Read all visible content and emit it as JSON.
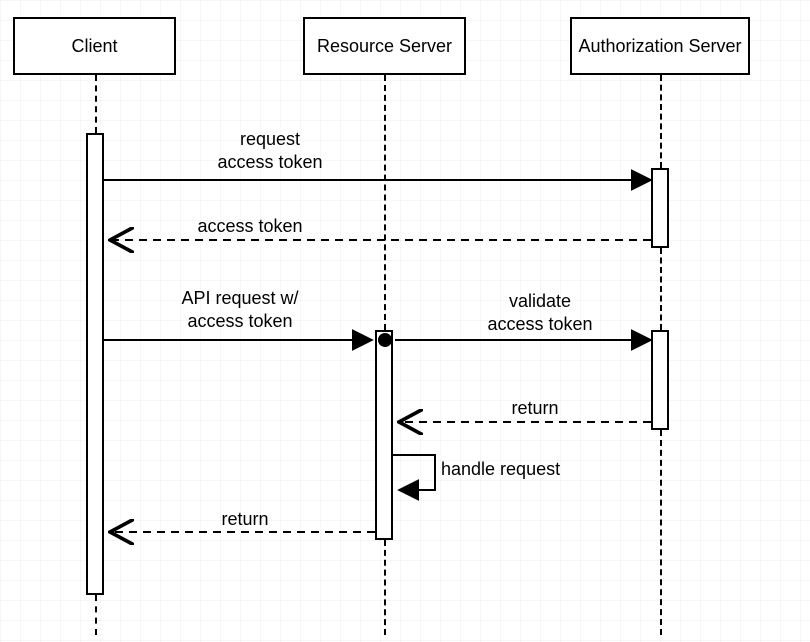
{
  "actors": {
    "client": "Client",
    "resource": "Resource\nServer",
    "auth": "Authorization\nServer"
  },
  "messages": {
    "m1": "request\naccess token",
    "m2": "access token",
    "m3": "API request w/\naccess token",
    "m4": "validate\naccess token",
    "m5": "return",
    "m6": "handle request",
    "m7": "return"
  }
}
